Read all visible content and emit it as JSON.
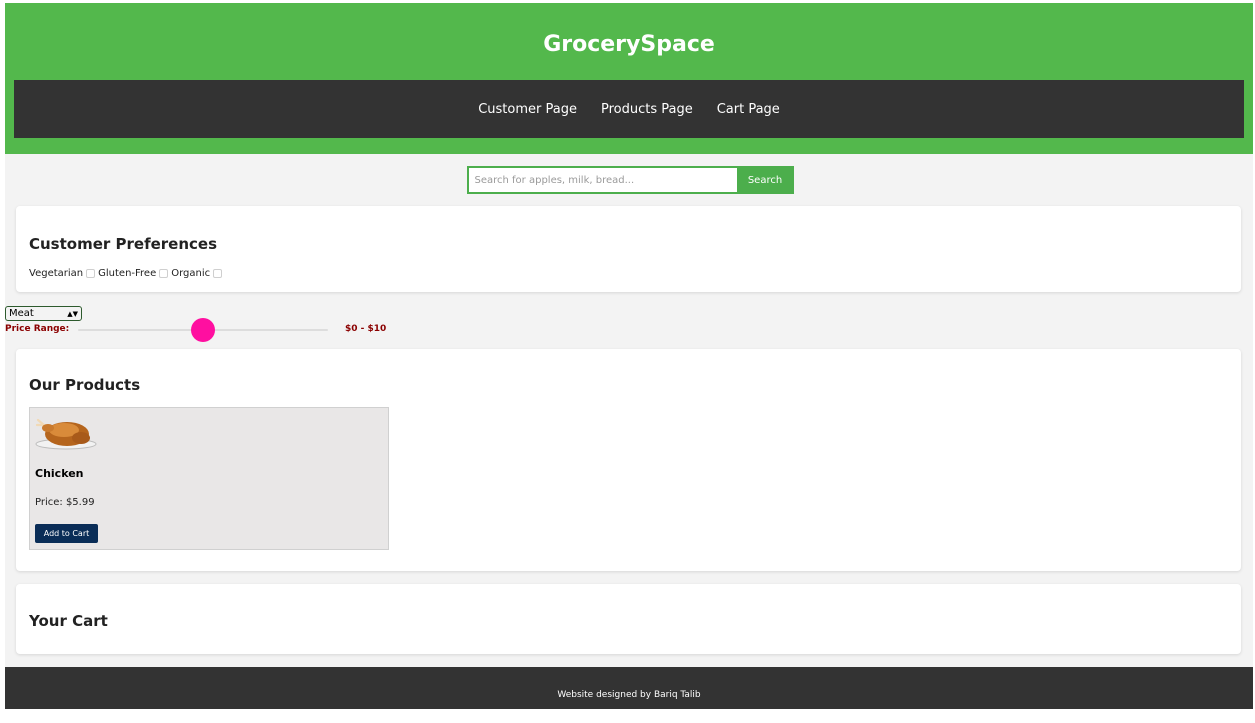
{
  "header": {
    "title": "GrocerySpace",
    "nav": [
      {
        "label": "Customer Page"
      },
      {
        "label": "Products Page"
      },
      {
        "label": "Cart Page"
      }
    ]
  },
  "search": {
    "placeholder": "Search for apples, milk, bread...",
    "value": "",
    "button_label": "Search"
  },
  "preferences": {
    "heading": "Customer Preferences",
    "options": [
      {
        "label": "Vegetarian",
        "checked": false
      },
      {
        "label": "Gluten-Free",
        "checked": false
      },
      {
        "label": "Organic",
        "checked": false
      }
    ]
  },
  "filters": {
    "category_selected": "Meat",
    "price_label": "Price Range:",
    "price_value_text": "$0 - $10",
    "slider_fraction": 0.5,
    "colors": {
      "label": "#8b0000",
      "thumb": "#ff0fa0"
    }
  },
  "products": {
    "heading": "Our Products",
    "items": [
      {
        "name": "Chicken",
        "price_text": "Price: $5.99",
        "button_label": "Add to Cart",
        "icon": "roast-chicken-image"
      }
    ]
  },
  "cart": {
    "heading": "Your Cart"
  },
  "footer": {
    "text": "Website designed by Bariq Talib"
  },
  "colors": {
    "brand_green": "#53b84c",
    "nav_dark": "#333333",
    "button_navy": "#0a2d57"
  }
}
